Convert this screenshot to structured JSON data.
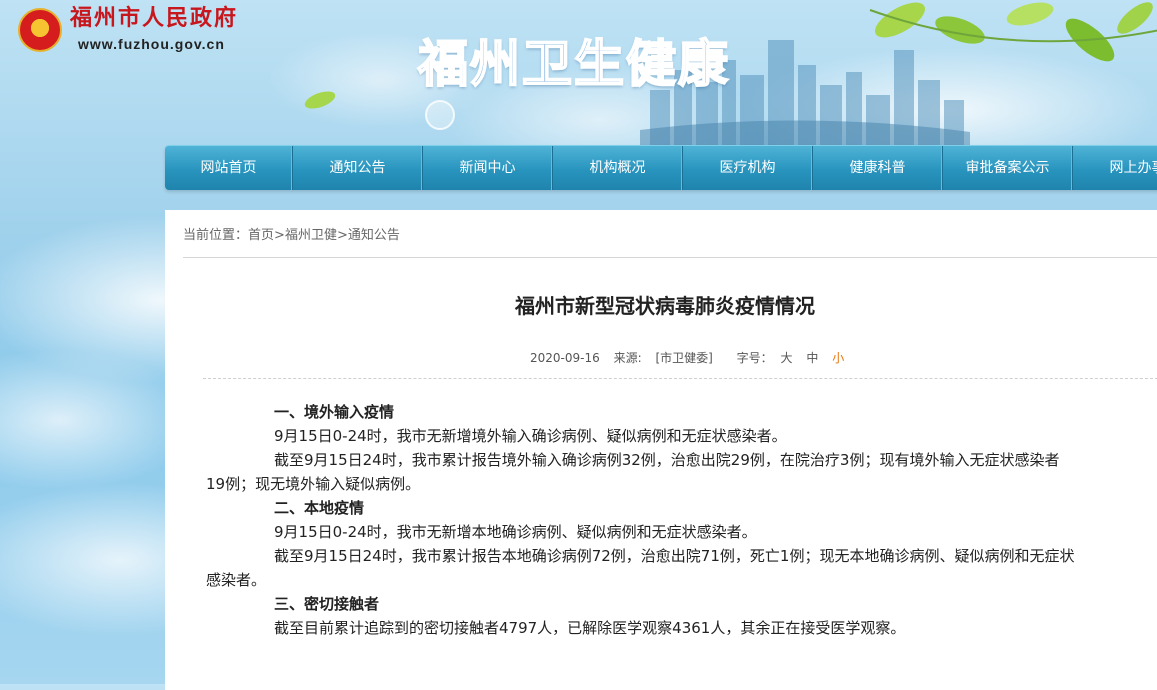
{
  "header": {
    "gov_name": "福州市人民政府",
    "gov_url": "www.fuzhou.gov.cn",
    "site_title": "福州卫生健康"
  },
  "nav": {
    "items": [
      {
        "label": "网站首页"
      },
      {
        "label": "通知公告"
      },
      {
        "label": "新闻中心"
      },
      {
        "label": "机构概况"
      },
      {
        "label": "医疗机构"
      },
      {
        "label": "健康科普"
      },
      {
        "label": "审批备案公示"
      },
      {
        "label": "网上办事"
      }
    ]
  },
  "breadcrumb": {
    "prefix": "当前位置：",
    "items": [
      "首页",
      "福州卫健",
      "通知公告"
    ],
    "separator": ">"
  },
  "article": {
    "title": "福州市新型冠状病毒肺炎疫情情况",
    "date": "2020-09-16",
    "source_label": "来源:",
    "source": "[市卫健委]",
    "font_size_label": "字号：",
    "font_sizes": [
      "大",
      "中",
      "小"
    ],
    "paragraphs": [
      {
        "type": "heading",
        "text": "一、境外输入疫情"
      },
      {
        "type": "para",
        "text": "9月15日0-24时，我市无新增境外输入确诊病例、疑似病例和无症状感染者。"
      },
      {
        "type": "para",
        "text": "截至9月15日24时，我市累计报告境外输入确诊病例32例，治愈出院29例，在院治疗3例；现有境外输入无症状感染者"
      },
      {
        "type": "cont",
        "text": "19例；现无境外输入疑似病例。"
      },
      {
        "type": "heading",
        "text": "二、本地疫情"
      },
      {
        "type": "para",
        "text": "9月15日0-24时，我市无新增本地确诊病例、疑似病例和无症状感染者。"
      },
      {
        "type": "para",
        "text": "截至9月15日24时，我市累计报告本地确诊病例72例，治愈出院71例，死亡1例；现无本地确诊病例、疑似病例和无症状"
      },
      {
        "type": "cont",
        "text": "感染者。"
      },
      {
        "type": "heading",
        "text": "三、密切接触者"
      },
      {
        "type": "para",
        "text": "截至目前累计追踪到的密切接触者4797人，已解除医学观察4361人，其余正在接受医学观察。"
      }
    ]
  },
  "colors": {
    "nav_bg": "#2894be",
    "gov_red": "#c8161d",
    "title_blue": "#1a73c9",
    "font_small_active": "#e8770e"
  }
}
